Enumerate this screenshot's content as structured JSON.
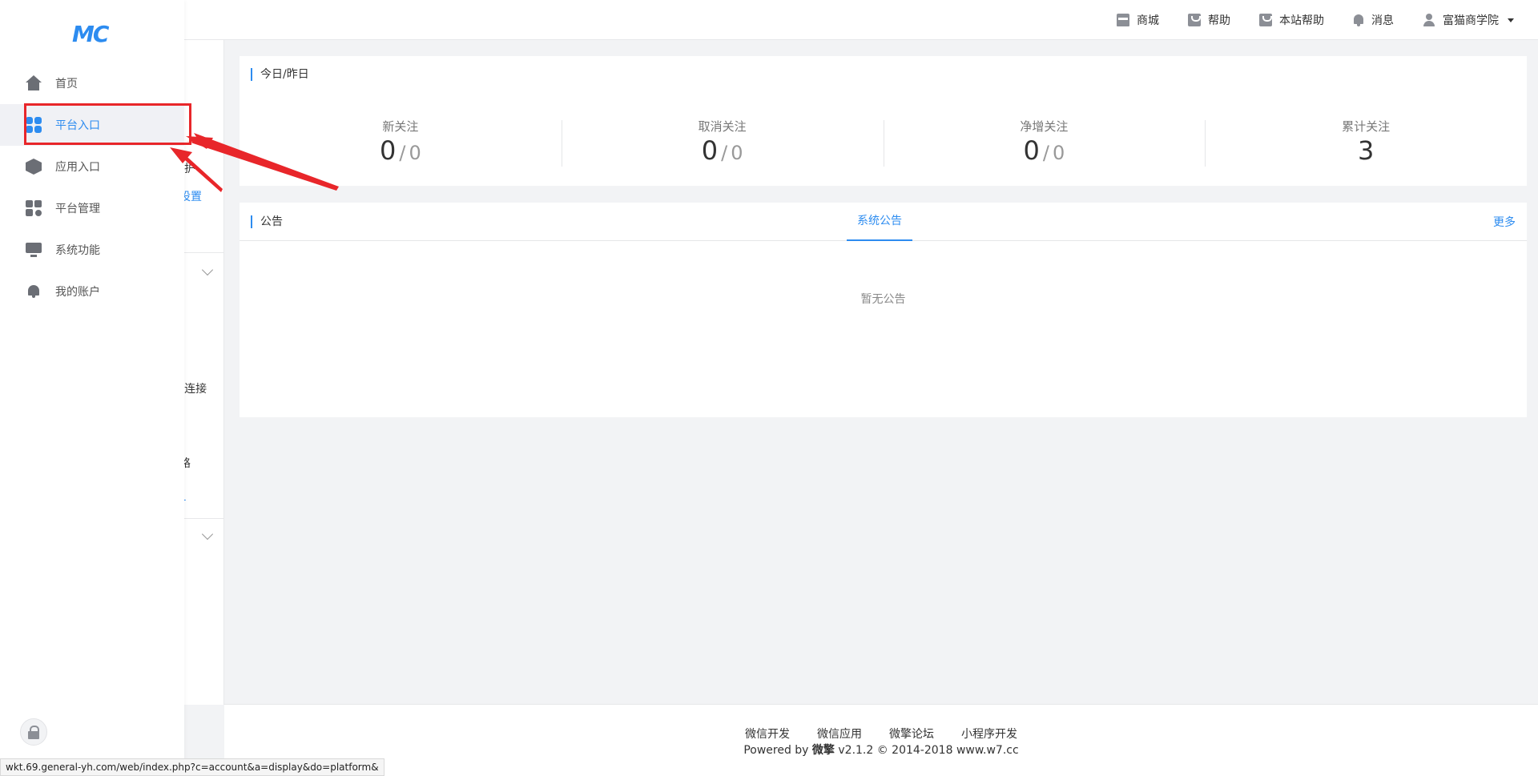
{
  "header": {
    "nav": [
      {
        "label": "商城",
        "icon": "store-icon"
      },
      {
        "label": "帮助",
        "icon": "bag-icon"
      },
      {
        "label": "本站帮助",
        "icon": "bag-icon"
      },
      {
        "label": "消息",
        "icon": "bell-icon"
      },
      {
        "label": "富猫商学院",
        "icon": "user-icon"
      }
    ]
  },
  "sidebar": {
    "logo": "MC",
    "items": [
      {
        "label": "首页",
        "icon": "home-icon"
      },
      {
        "label": "平台入口",
        "icon": "grid-icon",
        "active": true
      },
      {
        "label": "应用入口",
        "icon": "cube-icon"
      },
      {
        "label": "平台管理",
        "icon": "apps-icon"
      },
      {
        "label": "系统功能",
        "icon": "monitor-icon"
      },
      {
        "label": "我的账户",
        "icon": "bell-icon"
      }
    ],
    "lock_icon": "lock-icon"
  },
  "subpanel": {
    "fragments": [
      "护",
      "设置",
      "J连接",
      "路",
      "L"
    ]
  },
  "stats_card": {
    "title": "今日/昨日",
    "items": [
      {
        "label": "新关注",
        "today": "0",
        "yesterday": "0"
      },
      {
        "label": "取消关注",
        "today": "0",
        "yesterday": "0"
      },
      {
        "label": "净增关注",
        "today": "0",
        "yesterday": "0"
      },
      {
        "label": "累计关注",
        "total": "3"
      }
    ],
    "separator": "/"
  },
  "notice_card": {
    "title": "公告",
    "tab": "系统公告",
    "more": "更多",
    "empty": "暂无公告"
  },
  "footer": {
    "links": [
      "微信开发",
      "微信应用",
      "微擎论坛",
      "小程序开发"
    ],
    "powered_prefix": "Powered by",
    "brand": "微擎",
    "version_text": "v2.1.2 © 2014-2018 www.w7.cc"
  },
  "statusbar": {
    "url": "wkt.69.general-yh.com/web/index.php?c=account&a=display&do=platform&"
  },
  "colors": {
    "accent": "#2d8cf0",
    "annotation": "#e8262a"
  }
}
